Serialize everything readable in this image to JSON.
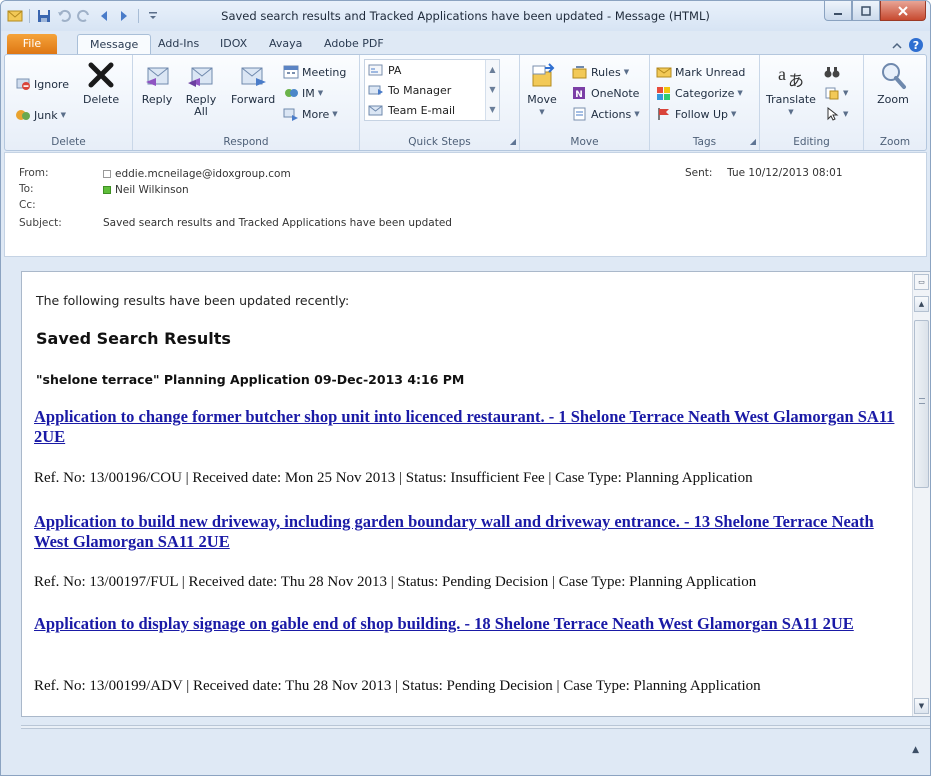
{
  "window": {
    "title": "Saved search results and Tracked Applications have been updated  -  Message (HTML)"
  },
  "ribbon_tabs": [
    "File",
    "Message",
    "Add-Ins",
    "IDOX",
    "Avaya",
    "Adobe PDF"
  ],
  "ribbon": {
    "delete_group": {
      "label": "Delete",
      "ignore": "Ignore",
      "junk": "Junk",
      "delete": "Delete"
    },
    "respond_group": {
      "label": "Respond",
      "reply": "Reply",
      "reply_all_1": "Reply",
      "reply_all_2": "All",
      "forward": "Forward",
      "meeting": "Meeting",
      "im": "IM",
      "more": "More"
    },
    "quick_steps_group": {
      "label": "Quick Steps",
      "items": [
        "PA",
        "To Manager",
        "Team E-mail"
      ]
    },
    "move_group": {
      "label": "Move",
      "move": "Move",
      "rules": "Rules",
      "onenote": "OneNote",
      "actions": "Actions"
    },
    "tags_group": {
      "label": "Tags",
      "mark_unread": "Mark Unread",
      "categorize": "Categorize",
      "follow_up": "Follow Up"
    },
    "editing_group": {
      "label": "Editing",
      "translate": "Translate"
    },
    "zoom_group": {
      "label": "Zoom",
      "zoom": "Zoom"
    }
  },
  "header": {
    "from_label": "From:",
    "from_value": "eddie.mcneilage@idoxgroup.com",
    "to_label": "To:",
    "to_value": "Neil Wilkinson",
    "cc_label": "Cc:",
    "subject_label": "Subject:",
    "subject_value": "Saved search results and Tracked Applications have been updated",
    "sent_label": "Sent:",
    "sent_value": "Tue 10/12/2013 08:01"
  },
  "body": {
    "intro": "The following results have been updated recently:",
    "section_title": "Saved Search Results",
    "search_heading": "\"shelone terrace\" Planning Application 09-Dec-2013 4:16 PM",
    "applications": [
      {
        "link": "Application to change former butcher shop unit into licenced restaurant. - 1 Shelone Terrace Neath West Glamorgan SA11 2UE",
        "meta": "Ref. No: 13/00196/COU | Received date: Mon 25 Nov 2013 | Status: Insufficient Fee | Case Type: Planning Application"
      },
      {
        "link": "Application to build new driveway, including garden boundary wall and driveway entrance. - 13 Shelone Terrace Neath West Glamorgan SA11 2UE",
        "meta": "Ref. No: 13/00197/FUL | Received date: Thu 28 Nov 2013 | Status: Pending Decision | Case Type: Planning Application"
      },
      {
        "link": "Application to display signage on gable end of shop building. - 18 Shelone Terrace Neath West Glamorgan SA11 2UE",
        "meta": "Ref. No: 13/00199/ADV | Received date: Thu 28 Nov 2013 | Status: Pending Decision | Case Type: Planning Application"
      }
    ]
  },
  "colors": {
    "link": "#1a1aa6",
    "file_tab": "#e8871f",
    "close_button": "#c74a30"
  }
}
